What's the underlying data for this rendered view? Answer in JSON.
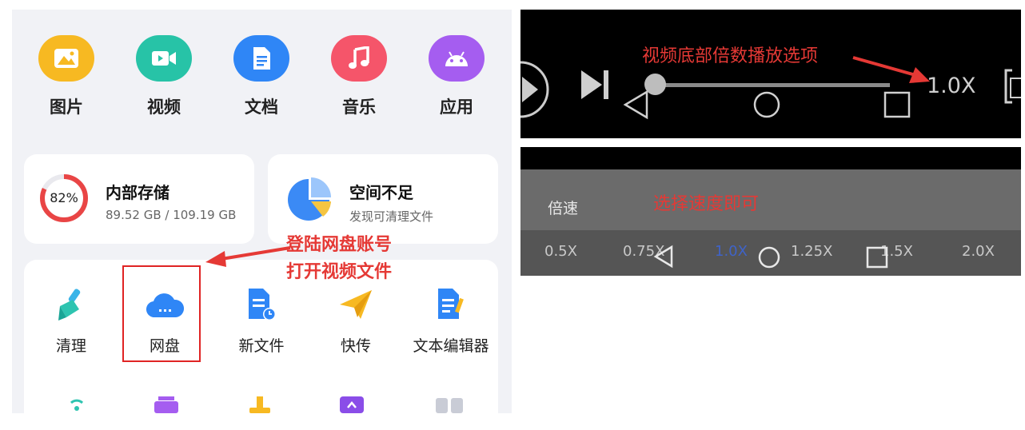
{
  "categories": [
    {
      "label": "图片",
      "icon": "image-icon",
      "color": "#f7b922"
    },
    {
      "label": "视频",
      "icon": "video-icon",
      "color": "#27c3a7"
    },
    {
      "label": "文档",
      "icon": "document-icon",
      "color": "#2f86f6"
    },
    {
      "label": "音乐",
      "icon": "music-icon",
      "color": "#f5556a"
    },
    {
      "label": "应用",
      "icon": "android-icon",
      "color": "#a55df0"
    }
  ],
  "storage": {
    "percent_label": "82%",
    "percent": 82,
    "title": "内部存储",
    "detail": "89.52 GB / 109.19 GB"
  },
  "space": {
    "title": "空间不足",
    "subtitle": "发现可清理文件"
  },
  "tools": [
    {
      "label": "清理",
      "icon": "broom-icon"
    },
    {
      "label": "网盘",
      "icon": "cloud-drive-icon"
    },
    {
      "label": "新文件",
      "icon": "new-file-icon"
    },
    {
      "label": "快传",
      "icon": "paper-plane-icon"
    },
    {
      "label": "文本编辑器",
      "icon": "text-editor-icon"
    }
  ],
  "annotations": {
    "login_line1": "登陆网盘账号",
    "login_line2": "打开视频文件",
    "speed_option": "视频底部倍数播放选项",
    "choose_speed": "选择速度即可"
  },
  "player": {
    "speed_indicator": "1.0X",
    "progress": 0.0
  },
  "speed_menu": {
    "title": "倍速",
    "options": [
      "0.5X",
      "0.75X",
      "1.0X",
      "1.25X",
      "1.5X",
      "2.0X"
    ],
    "selected": "1.0X"
  },
  "colors": {
    "annotation_red": "#e53935",
    "accent_blue": "#2f86f6"
  }
}
